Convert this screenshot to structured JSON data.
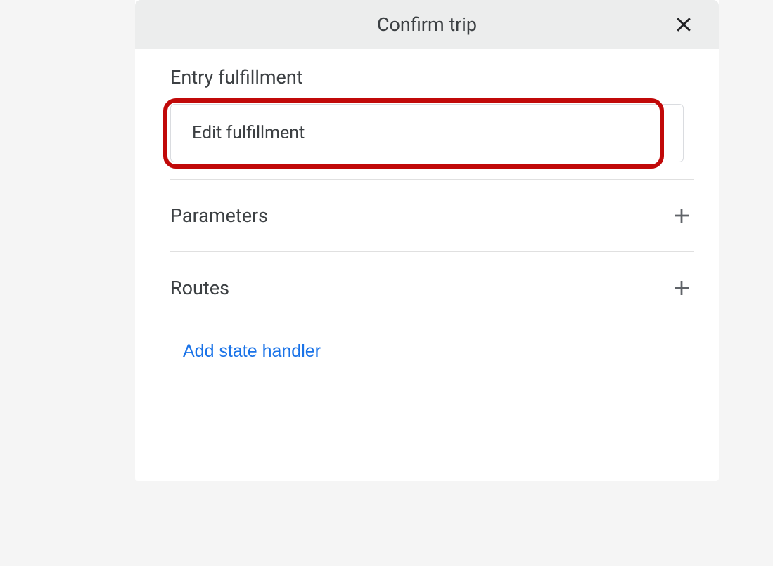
{
  "header": {
    "title": "Confirm trip"
  },
  "entry_fulfillment": {
    "label": "Entry fulfillment",
    "edit_label": "Edit fulfillment"
  },
  "sections": {
    "parameters": {
      "label": "Parameters"
    },
    "routes": {
      "label": "Routes"
    }
  },
  "add_state_handler_label": "Add state handler"
}
